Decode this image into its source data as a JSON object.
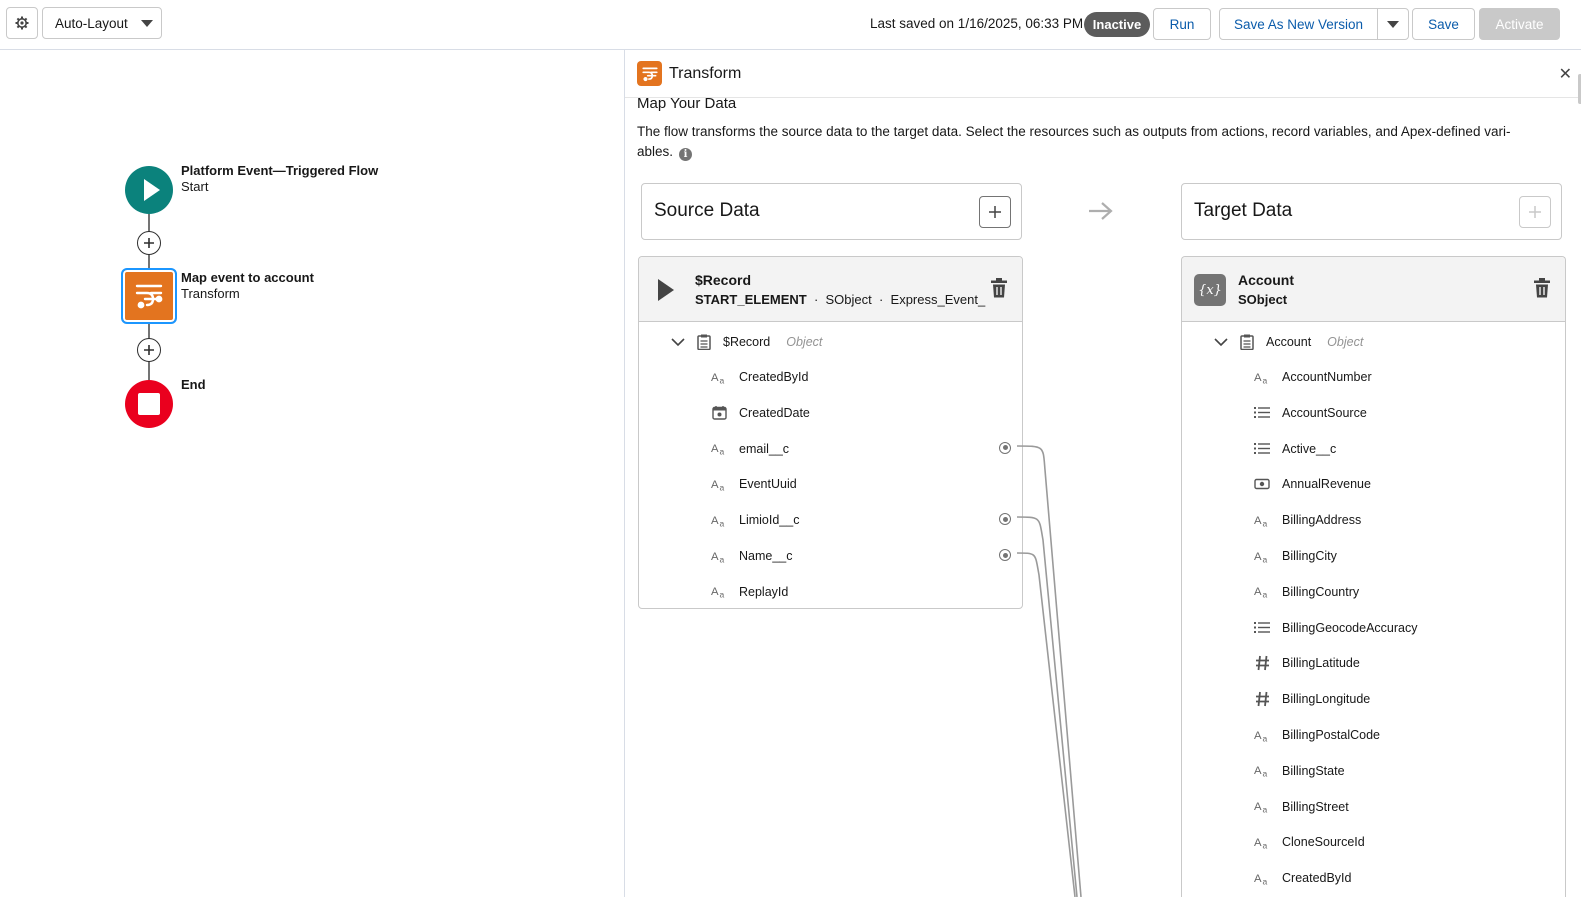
{
  "toolbar": {
    "layout_label": "Auto-Layout",
    "last_saved": "Last saved on 1/16/2025, 06:33 PM",
    "status_badge": "Inactive",
    "run_label": "Run",
    "save_as_label": "Save As New Version",
    "save_label": "Save",
    "activate_label": "Activate"
  },
  "canvas": {
    "start": {
      "title": "Platform Event—Triggered Flow",
      "subtitle": "Start"
    },
    "transform": {
      "title": "Map event to account",
      "subtitle": "Transform"
    },
    "end": {
      "title": "End"
    }
  },
  "panel": {
    "title": "Transform",
    "section_title": "Map Your Data",
    "description_line1": "The flow transforms the source data to the target data. Select the resources such as outputs from actions, record variables, and Apex-defined vari-",
    "description_line2": "ables.",
    "source_header": "Source Data",
    "target_header": "Target Data",
    "source": {
      "name": "$Record",
      "meta_1": "START_ELEMENT",
      "meta_2": "SObject",
      "meta_3": "Express_Event_",
      "root_label": "$Record",
      "root_type": "Object",
      "fields": [
        {
          "label": "CreatedById",
          "icon": "text-icon"
        },
        {
          "label": "CreatedDate",
          "icon": "calendar-icon"
        },
        {
          "label": "email__c",
          "icon": "text-icon"
        },
        {
          "label": "EventUuid",
          "icon": "text-icon"
        },
        {
          "label": "LimioId__c",
          "icon": "text-icon"
        },
        {
          "label": "Name__c",
          "icon": "text-icon"
        },
        {
          "label": "ReplayId",
          "icon": "text-icon"
        }
      ]
    },
    "target": {
      "name": "Account",
      "meta": "SObject",
      "root_label": "Account",
      "root_type": "Object",
      "fields": [
        {
          "label": "AccountNumber",
          "icon": "text-icon"
        },
        {
          "label": "AccountSource",
          "icon": "picklist-icon"
        },
        {
          "label": "Active__c",
          "icon": "picklist-icon"
        },
        {
          "label": "AnnualRevenue",
          "icon": "currency-icon"
        },
        {
          "label": "BillingAddress",
          "icon": "text-icon"
        },
        {
          "label": "BillingCity",
          "icon": "text-icon"
        },
        {
          "label": "BillingCountry",
          "icon": "text-icon"
        },
        {
          "label": "BillingGeocodeAccuracy",
          "icon": "picklist-icon"
        },
        {
          "label": "BillingLatitude",
          "icon": "number-icon"
        },
        {
          "label": "BillingLongitude",
          "icon": "number-icon"
        },
        {
          "label": "BillingPostalCode",
          "icon": "text-icon"
        },
        {
          "label": "BillingState",
          "icon": "text-icon"
        },
        {
          "label": "BillingStreet",
          "icon": "text-icon"
        },
        {
          "label": "CloneSourceId",
          "icon": "text-icon"
        },
        {
          "label": "CreatedById",
          "icon": "text-icon"
        }
      ]
    }
  }
}
